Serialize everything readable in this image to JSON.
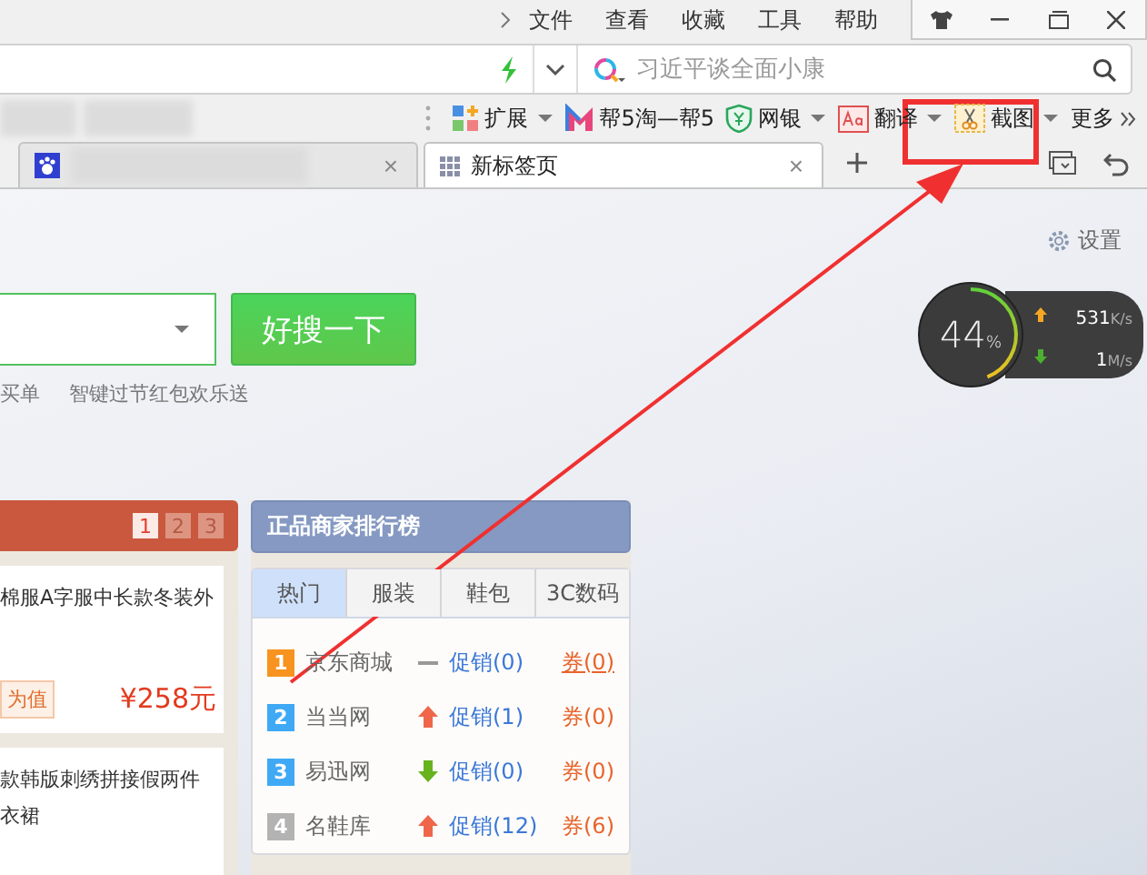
{
  "menu": [
    "文件",
    "查看",
    "收藏",
    "工具",
    "帮助"
  ],
  "search_bar": {
    "placeholder": "习近平谈全面小康"
  },
  "toolbar": [
    {
      "label": "扩展",
      "kind": "extensions",
      "dropdown": true
    },
    {
      "label": "帮5淘—帮5",
      "kind": "shop",
      "dropdown": false
    },
    {
      "label": "网银",
      "kind": "bank",
      "dropdown": true
    },
    {
      "label": "翻译",
      "kind": "translate",
      "dropdown": true
    },
    {
      "label": "截图",
      "kind": "screenshot",
      "dropdown": true
    },
    {
      "label": "更多",
      "kind": "more",
      "dropdown": false
    }
  ],
  "tabs": [
    {
      "close": "×",
      "selected": false
    },
    {
      "title": "新标签页",
      "close": "×",
      "selected": true
    }
  ],
  "settings": "设置",
  "search_button": "好搜一下",
  "hot_links": [
    "买单",
    "智键过节红包欢乐送"
  ],
  "net_monitor": {
    "percent": "44",
    "unit": "%",
    "level": 0.44,
    "upload": "531",
    "upload_unit": "K/s",
    "download": "1",
    "download_unit": "M/s"
  },
  "deals": {
    "pages": [
      {
        "label": "1",
        "selected": true
      },
      {
        "label": "2",
        "selected": false
      },
      {
        "label": "3",
        "selected": false
      }
    ],
    "items": [
      {
        "lines": [
          "棉服A字服中长款冬装外"
        ],
        "tag": "为值",
        "price": "¥258元"
      },
      {
        "lines": [
          "款韩版刺绣拼接假两件",
          "衣裙"
        ]
      }
    ]
  },
  "ranking": {
    "title": "正品商家排行榜",
    "tabs": [
      {
        "label": "热门",
        "selected": true
      },
      {
        "label": "服装",
        "selected": false
      },
      {
        "label": "鞋包",
        "selected": false
      },
      {
        "label": "3C数码",
        "selected": false
      }
    ],
    "rows": [
      {
        "rank": "1",
        "name": "京东商城",
        "kind": "flat",
        "promo": "促销(0)",
        "coupon": "券(0)",
        "color": "#f7931e"
      },
      {
        "rank": "2",
        "name": "当当网",
        "kind": "up",
        "promo": "促销(1)",
        "coupon": "券(0)",
        "color": "#3fa9f5"
      },
      {
        "rank": "3",
        "name": "易迅网",
        "kind": "down",
        "promo": "促销(0)",
        "coupon": "券(0)",
        "color": "#3fa9f5"
      },
      {
        "rank": "4",
        "name": "名鞋库",
        "kind": "up",
        "promo": "促销(12)",
        "coupon": "券(6)",
        "color": "#b3b3b3"
      }
    ]
  }
}
